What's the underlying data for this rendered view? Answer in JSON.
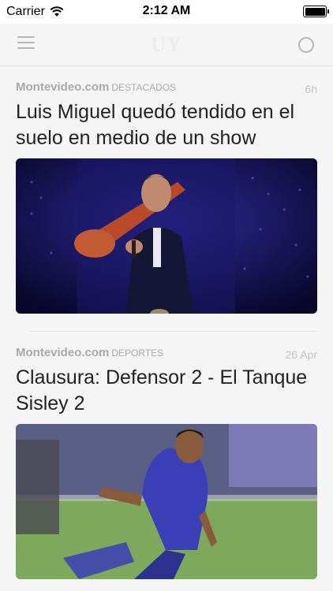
{
  "status_bar": {
    "carrier": "Carrier",
    "time": "2:12 AM",
    "battery_level": 1.0
  },
  "nav": {
    "title": "UY",
    "menu_icon": "hamburger-menu-icon",
    "right_icon": "circle-icon"
  },
  "articles": [
    {
      "source": "Montevideo.com",
      "category": "DESTACADOS",
      "age": "6h",
      "headline": "Luis Miguel quedó tendido en el suelo en medio de un show",
      "image": "concert-photo"
    },
    {
      "source": "Montevideo.com",
      "category": "DEPORTES",
      "age": "26 Apr",
      "headline": "Clausura: Defensor 2 - El Tanque Sisley 2",
      "image": "soccer-photo"
    }
  ]
}
